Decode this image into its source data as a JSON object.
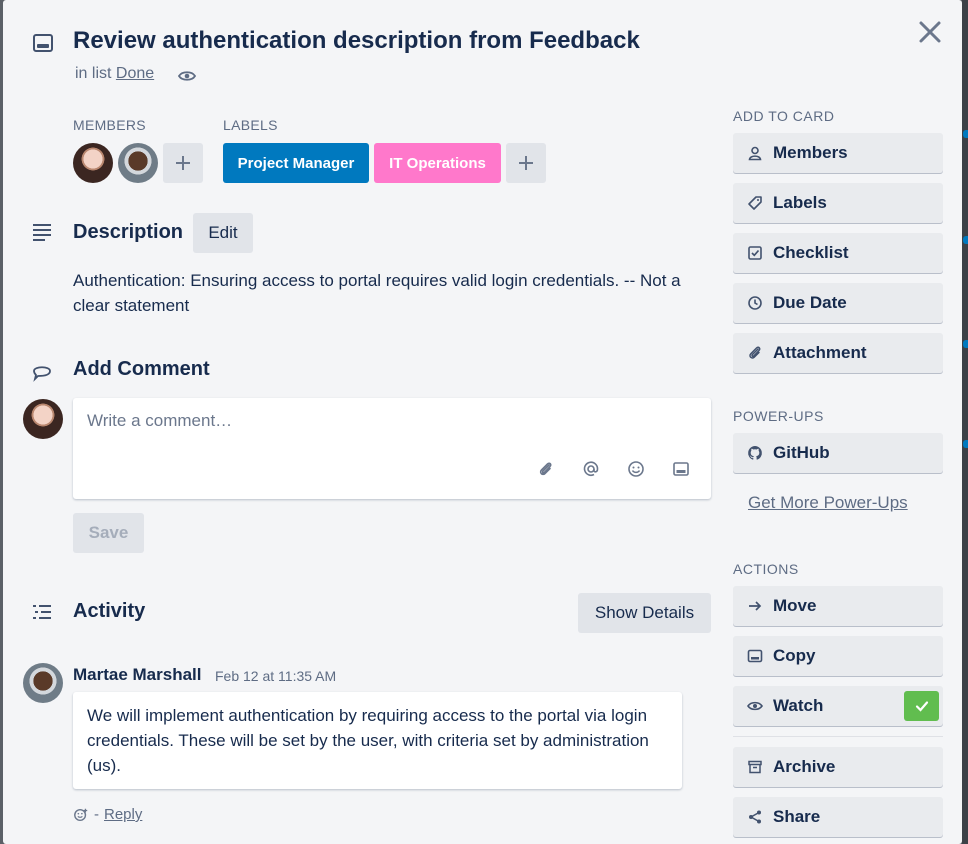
{
  "card": {
    "title": "Review authentication description from Feedback",
    "in_list_prefix": "in list",
    "list_name": "Done"
  },
  "members": {
    "heading": "MEMBERS",
    "avatars": [
      "female-member-avatar",
      "male-member-avatar"
    ]
  },
  "labels": {
    "heading": "LABELS",
    "items": [
      {
        "name": "Project Manager",
        "color": "#0079bf"
      },
      {
        "name": "IT Operations",
        "color": "#ff78cb"
      }
    ]
  },
  "description": {
    "heading": "Description",
    "edit_label": "Edit",
    "text": "Authentication: Ensuring access to portal requires valid login credentials. -- Not a clear statement"
  },
  "comment": {
    "heading": "Add Comment",
    "placeholder": "Write a comment…",
    "save_label": "Save",
    "toolbar_icons": [
      "attachment-icon",
      "mention-icon",
      "emoji-icon",
      "card-icon"
    ]
  },
  "activity": {
    "heading": "Activity",
    "show_details_label": "Show Details",
    "items": [
      {
        "author": "Martae Marshall",
        "time": "Feb 12 at 11:35 AM",
        "text": "We will implement authentication by requiring access to the portal via login credentials. These will be set by the user, with criteria set by administration (us).",
        "reply_label": "Reply",
        "separator": "-"
      }
    ]
  },
  "sidebar": {
    "add_to_card": {
      "heading": "ADD TO CARD",
      "buttons": [
        {
          "label": "Members",
          "icon": "person-icon"
        },
        {
          "label": "Labels",
          "icon": "tag-icon"
        },
        {
          "label": "Checklist",
          "icon": "checkbox-icon"
        },
        {
          "label": "Due Date",
          "icon": "clock-icon"
        },
        {
          "label": "Attachment",
          "icon": "paperclip-icon"
        }
      ]
    },
    "power_ups": {
      "heading": "POWER-UPS",
      "github_label": "GitHub",
      "more_label": "Get More Power-Ups"
    },
    "actions": {
      "heading": "ACTIONS",
      "buttons": [
        {
          "label": "Move",
          "icon": "arrow-right-icon"
        },
        {
          "label": "Copy",
          "icon": "card-icon"
        },
        {
          "label": "Watch",
          "icon": "eye-icon",
          "checked": true
        },
        {
          "label": "Archive",
          "icon": "archive-icon"
        },
        {
          "label": "Share",
          "icon": "share-icon"
        }
      ]
    }
  },
  "colors": {
    "accent_green": "#61bd4f",
    "text_primary": "#172b4d",
    "text_muted": "#5e6c84"
  }
}
